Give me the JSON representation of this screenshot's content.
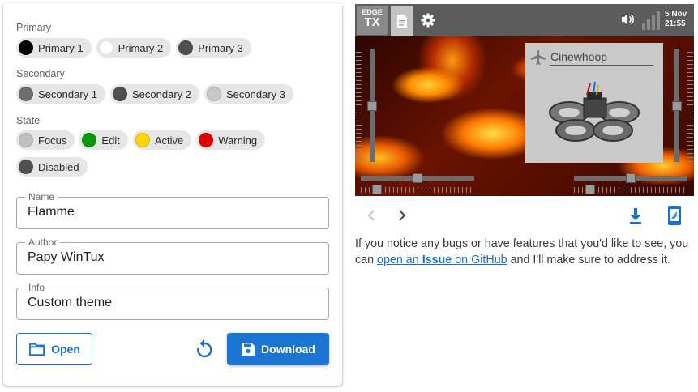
{
  "colors": {
    "accent": "#1c75d3",
    "accent_border": "#1b6ec2"
  },
  "sections": {
    "primary": {
      "title": "Primary",
      "chips": [
        {
          "label": "Primary 1",
          "color": "#000000"
        },
        {
          "label": "Primary 2",
          "color": "#ffffff"
        },
        {
          "label": "Primary 3",
          "color": "#505050"
        }
      ]
    },
    "secondary": {
      "title": "Secondary",
      "chips": [
        {
          "label": "Secondary 1",
          "color": "#6e6e6e"
        },
        {
          "label": "Secondary 2",
          "color": "#505050"
        },
        {
          "label": "Secondary 3",
          "color": "#c8c8c8"
        }
      ]
    },
    "state": {
      "title": "State",
      "chips": [
        {
          "label": "Focus",
          "color": "#c0c0c0"
        },
        {
          "label": "Edit",
          "color": "#0a9a0a"
        },
        {
          "label": "Active",
          "color": "#ffd400"
        },
        {
          "label": "Warning",
          "color": "#e00000"
        },
        {
          "label": "Disabled",
          "color": "#505050"
        }
      ]
    }
  },
  "form": {
    "name": {
      "label": "Name",
      "value": "Flamme"
    },
    "author": {
      "label": "Author",
      "value": "Papy WinTux"
    },
    "info": {
      "label": "Info",
      "value": "Custom theme"
    }
  },
  "actions": {
    "open_label": "Open",
    "download_label": "Download",
    "reset_icon": "reset-icon"
  },
  "preview": {
    "logo_line1": "EDGE",
    "logo_line2": "TX",
    "date": "5 Nov",
    "time": "21:55",
    "model_name": "Cinewhoop"
  },
  "note": {
    "text_before": "If you notice any bugs or have features that you'd like to see, you can ",
    "link_prefix": "open an ",
    "link_bold": "Issue",
    "link_suffix": " on GitHub",
    "text_after": " and I'll make sure to address it."
  }
}
